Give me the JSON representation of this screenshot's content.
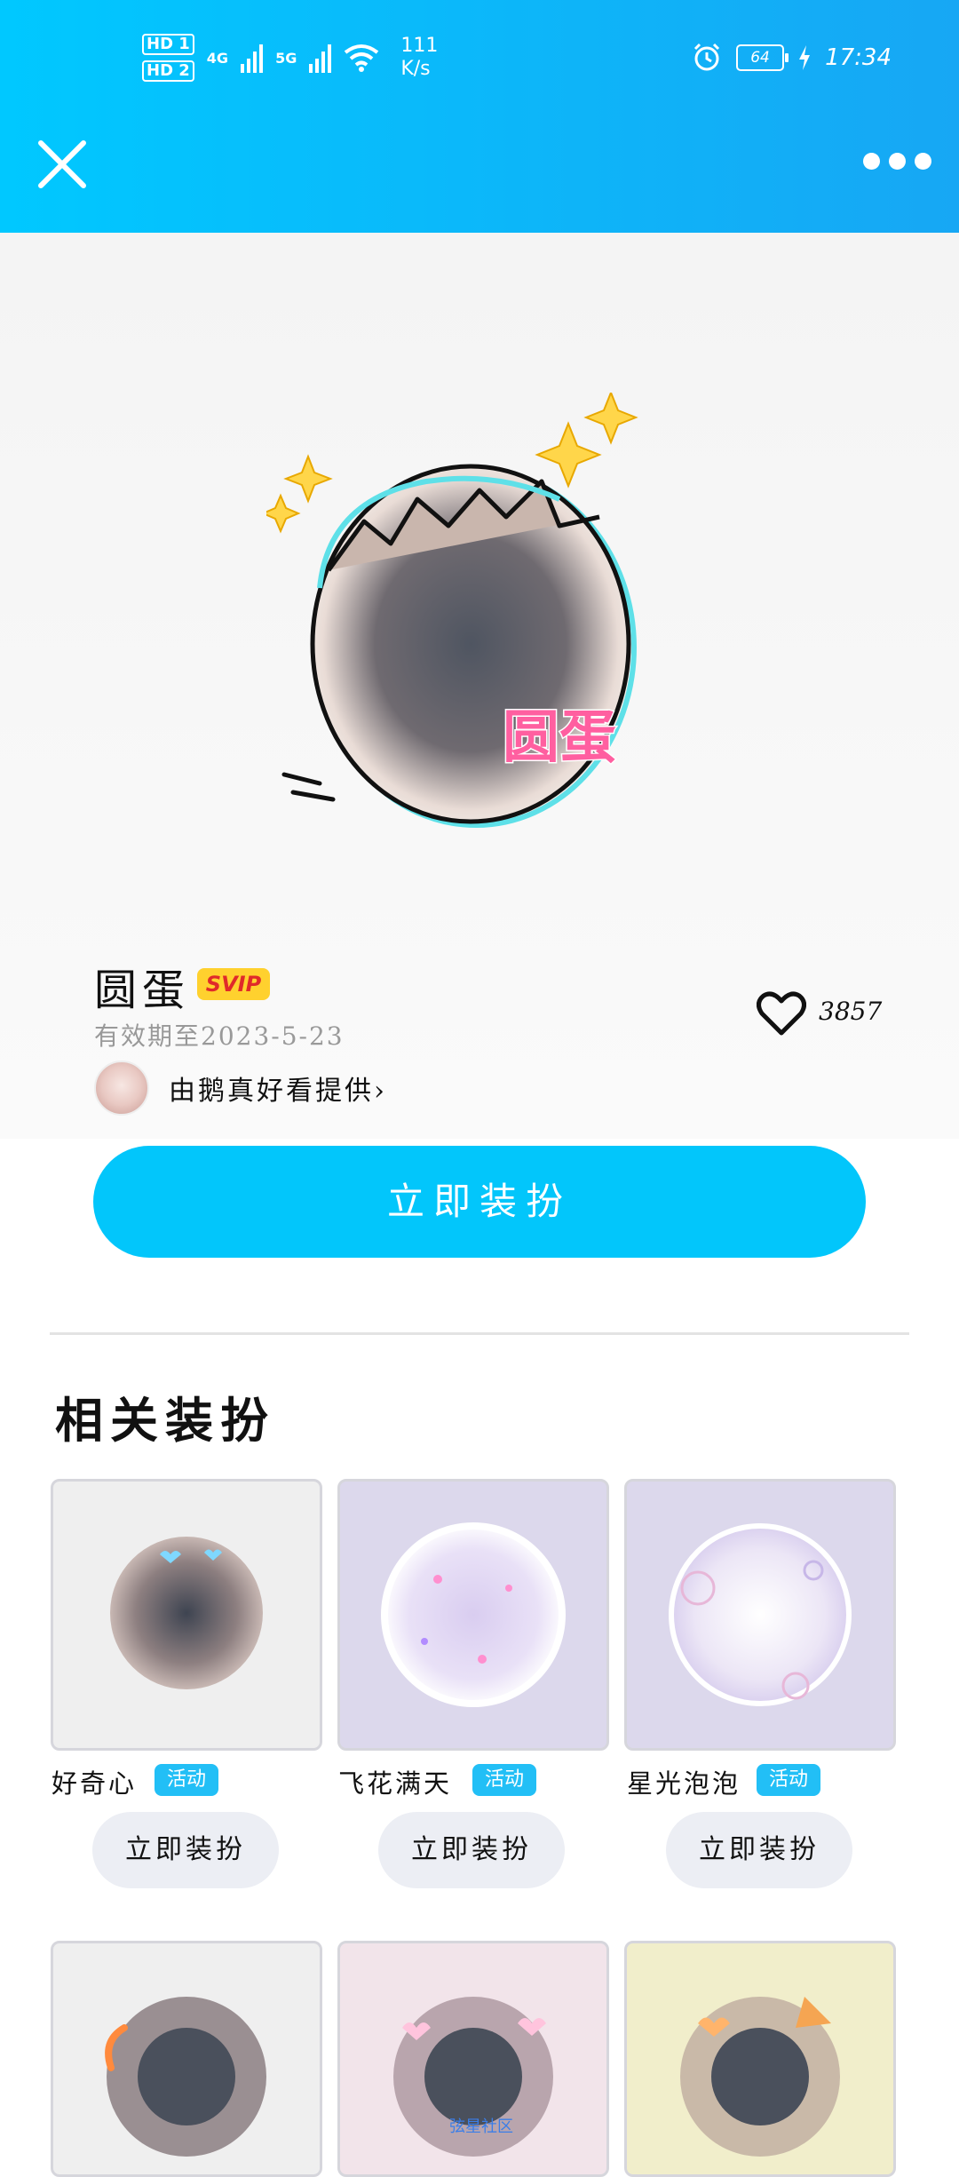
{
  "status_bar": {
    "hd1": "HD 1",
    "hd2": "HD 2",
    "net1": "4G",
    "net2": "5G",
    "speed_value": "111",
    "speed_unit": "K/s",
    "battery": "64",
    "time": "17:34"
  },
  "header": {
    "close_icon": "close-icon",
    "more_icon": "more-icon"
  },
  "item": {
    "title": "圆蛋",
    "badge": "SVIP",
    "expiry": "有效期至2023-5-23",
    "provider": "由鹅真好看提供›",
    "like_count": "3857",
    "apply_label": "立即装扮",
    "art_label": "圆蛋"
  },
  "related": {
    "title": "相关装扮",
    "items": [
      {
        "name": "好奇心",
        "tag": "活动",
        "button": "立即装扮"
      },
      {
        "name": "飞花满天",
        "tag": "活动",
        "button": "立即装扮"
      },
      {
        "name": "星光泡泡",
        "tag": "活动",
        "button": "立即装扮"
      }
    ]
  },
  "watermark": "弦星社区",
  "colors": {
    "header_start": "#00c8ff",
    "header_end": "#17a7f4",
    "accent": "#02c6fb",
    "badge": "#ffd12e",
    "tag": "#22bff6"
  }
}
